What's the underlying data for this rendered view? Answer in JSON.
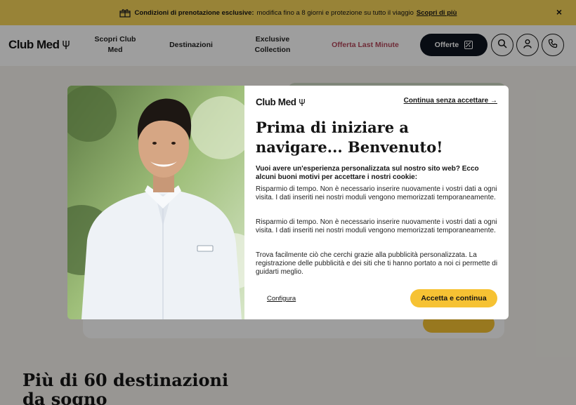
{
  "promo": {
    "title": "Condizioni di prenotazione esclusive:",
    "text": "modifica fino a 8 giorni e protezione su tutto il viaggio",
    "link": "Scopri di più",
    "close": "×"
  },
  "header": {
    "logo": "Club Med",
    "nav": [
      "Scopri Club Med",
      "Destinazioni",
      "Exclusive Collection",
      "Offerta Last Minute"
    ],
    "offers_button": "Offerte"
  },
  "page": {
    "section_title": "Più di 60 destinazioni da sogno"
  },
  "modal": {
    "logo": "Club Med",
    "skip_link": "Continua senza accettare →",
    "title": "Prima di iniziare a navigare... Benvenuto!",
    "intro": "Vuoi avere un'esperienza personalizzata sul nostro sito web? Ecco alcuni buoni motivi per accettare i nostri cookie:",
    "paragraphs": [
      "Risparmio di tempo. Non è necessario inserire nuovamente i vostri dati a ogni visita. I dati inseriti nei nostri moduli vengono memorizzati temporaneamente.",
      "Risparmio di tempo. Non è necessario inserire nuovamente i vostri dati a ogni visita. I dati inseriti nei nostri moduli vengono memorizzati temporaneamente.",
      "Trova facilmente ciò che cerchi grazie alla pubblicità personalizzata. La registrazione delle pubblicità e dei siti che ti hanno portato a noi ci permette di guidarti meglio."
    ],
    "configure": "Configura",
    "accept": "Accetta e continua"
  },
  "colors": {
    "promo_bg": "#f6d35a",
    "accent_yellow": "#f6c233",
    "dark": "#0e1420",
    "last_minute": "#b4485b"
  },
  "icons": [
    "gift-icon",
    "close-icon",
    "trident-icon",
    "percent-icon",
    "search-icon",
    "user-icon",
    "phone-icon"
  ]
}
